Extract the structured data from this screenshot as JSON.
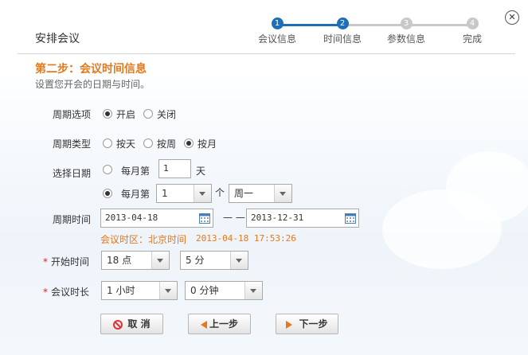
{
  "dialog": {
    "title": "安排会议",
    "close_glyph": "✕"
  },
  "steps": [
    {
      "num": "1",
      "label": "会议信息",
      "state": "done"
    },
    {
      "num": "2",
      "label": "时间信息",
      "state": "current"
    },
    {
      "num": "3",
      "label": "参数信息",
      "state": "todo"
    },
    {
      "num": "4",
      "label": "完成",
      "state": "todo"
    }
  ],
  "colors": {
    "accent_blue": "#1d6fb8",
    "accent_orange": "#e5781a",
    "step_gray": "#c8c8c8"
  },
  "heading": {
    "title": "第二步：会议时间信息",
    "description": "设置您开会的日期与时间。"
  },
  "form": {
    "cycle_option": {
      "label": "周期选项",
      "options": [
        "开启",
        "关闭"
      ],
      "selected": "开启"
    },
    "cycle_type": {
      "label": "周期类型",
      "options": [
        "按天",
        "按周",
        "按月"
      ],
      "selected": "按月"
    },
    "select_date": {
      "label": "选择日期",
      "opt1": {
        "prefix": "每月第",
        "value": "1",
        "suffix": "天"
      },
      "opt2": {
        "prefix": "每月第",
        "nth": "1",
        "unit": "个",
        "weekday": "周一"
      },
      "selected": "opt2"
    },
    "period_time": {
      "label": "周期时间",
      "start": "2013-04-18",
      "separator": "— —",
      "end": "2013-12-31"
    },
    "timezone": {
      "text": "会议时区：北京时间",
      "now": "2013-04-18 17:53:26"
    },
    "start_time": {
      "label": "开始时间",
      "required": "*",
      "hour": "18 点",
      "minute": "5 分"
    },
    "duration": {
      "label": "会议时长",
      "required": "*",
      "hours": "1 小时",
      "minutes": "0 分钟"
    }
  },
  "buttons": {
    "cancel": "取 消",
    "prev": "上一步",
    "next": "下一步"
  }
}
